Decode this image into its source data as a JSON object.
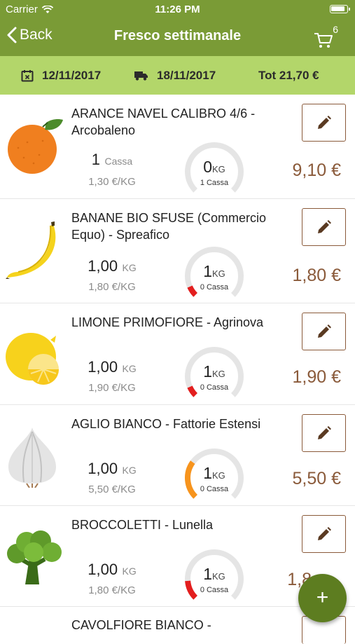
{
  "status": {
    "carrier": "Carrier",
    "time": "11:26 PM"
  },
  "nav": {
    "back_label": "Back",
    "title": "Fresco settimanale",
    "cart_count": "6"
  },
  "info": {
    "date_from": "12/11/2017",
    "date_delivery": "18/11/2017",
    "total": "Tot 21,70 €"
  },
  "colors": {
    "primary": "#7a9b36",
    "info_bar": "#b3d66a",
    "accent_brown": "#8a5a3a",
    "fab": "#5d7d20",
    "gauge_red": "#e31e1e",
    "gauge_orange": "#f7941d"
  },
  "products": [
    {
      "name": "ARANCE NAVEL CALIBRO 4/6 - Arcobaleno",
      "qty": "1",
      "unit": "Cassa",
      "unit_price": "1,30 €/KG",
      "gauge_value": "0",
      "gauge_unit": "KG",
      "gauge_sub": "1 Cassa",
      "price": "9,10 €",
      "icon": "orange-icon",
      "gauge_fill": 0.0
    },
    {
      "name": "BANANE BIO SFUSE (Commercio Equo) - Spreafico",
      "qty": "1,00",
      "unit": "KG",
      "unit_price": "1,80 €/KG",
      "gauge_value": "1",
      "gauge_unit": "KG",
      "gauge_sub": "0 Cassa",
      "price": "1,80 €",
      "icon": "banana-icon",
      "gauge_fill": 0.08
    },
    {
      "name": "LIMONE PRIMOFIORE - Agrinova",
      "qty": "1,00",
      "unit": "KG",
      "unit_price": "1,90 €/KG",
      "gauge_value": "1",
      "gauge_unit": "KG",
      "gauge_sub": "0 Cassa",
      "price": "1,90 €",
      "icon": "lemon-icon",
      "gauge_fill": 0.08
    },
    {
      "name": "AGLIO BIANCO - Fattorie Estensi",
      "qty": "1,00",
      "unit": "KG",
      "unit_price": "5,50 €/KG",
      "gauge_value": "1",
      "gauge_unit": "KG",
      "gauge_sub": "0 Cassa",
      "price": "5,50 €",
      "icon": "garlic-icon",
      "gauge_fill": 0.3
    },
    {
      "name": "BROCCOLETTI - Lunella",
      "qty": "1,00",
      "unit": "KG",
      "unit_price": "1,80 €/KG",
      "gauge_value": "1",
      "gauge_unit": "KG",
      "gauge_sub": "0 Cassa",
      "price": "1,8",
      "icon": "broccoli-icon",
      "gauge_fill": 0.15
    },
    {
      "name": "CAVOLFIORE BIANCO -"
    }
  ],
  "fab_label": "+"
}
